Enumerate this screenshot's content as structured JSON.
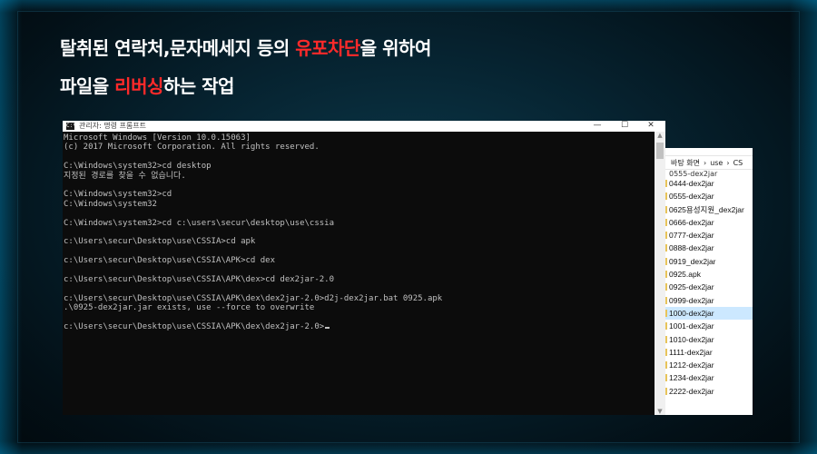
{
  "headline": {
    "line1_prefix": "탈취된 연락처,문자메세지 등의 ",
    "line1_highlight": "유포차단",
    "line1_suffix": "을 위하여",
    "line2_prefix": "파일을 ",
    "line2_highlight": "리버싱",
    "line2_suffix": "하는 작업"
  },
  "colors": {
    "highlight": "#ff2a2a",
    "terminal_bg": "#0c0c0c",
    "terminal_text": "#c0c0c0"
  },
  "cmd_window": {
    "title": "관리자: 명령 프롬프트",
    "icon": "cmd-icon",
    "controls": {
      "minimize": "—",
      "maximize": "☐",
      "close": "✕"
    },
    "lines": [
      "Microsoft Windows [Version 10.0.15063]",
      "(c) 2017 Microsoft Corporation. All rights reserved.",
      "",
      "C:\\Windows\\system32>cd desktop",
      "지정된 경로를 찾을 수 없습니다.",
      "",
      "C:\\Windows\\system32>cd",
      "C:\\Windows\\system32",
      "",
      "C:\\Windows\\system32>cd c:\\users\\secur\\desktop\\use\\cssia",
      "",
      "c:\\Users\\secur\\Desktop\\use\\CSSIA>cd apk",
      "",
      "c:\\Users\\secur\\Desktop\\use\\CSSIA\\APK>cd dex",
      "",
      "c:\\Users\\secur\\Desktop\\use\\CSSIA\\APK\\dex>cd dex2jar-2.0",
      "",
      "c:\\Users\\secur\\Desktop\\use\\CSSIA\\APK\\dex\\dex2jar-2.0>d2j-dex2jar.bat 0925.apk",
      ".\\0925-dex2jar.jar exists, use --force to overwrite",
      "",
      "c:\\Users\\secur\\Desktop\\use\\CSSIA\\APK\\dex\\dex2jar-2.0>"
    ]
  },
  "explorer": {
    "breadcrumb": [
      "바탕 화면",
      "›",
      "use",
      "›",
      "CS"
    ],
    "top_partial": "0555-dex2jar",
    "files": [
      "0444-dex2jar",
      "0555-dex2jar",
      "0625용성지원_dex2jar",
      "0666-dex2jar",
      "0777-dex2jar",
      "0888-dex2jar",
      "0919_dex2jar",
      "0925.apk",
      "0925-dex2jar",
      "0999-dex2jar",
      "1000-dex2jar",
      "1001-dex2jar",
      "1010-dex2jar",
      "1111-dex2jar",
      "1212-dex2jar",
      "1234-dex2jar",
      "2222-dex2jar"
    ],
    "selected_index": 10
  }
}
